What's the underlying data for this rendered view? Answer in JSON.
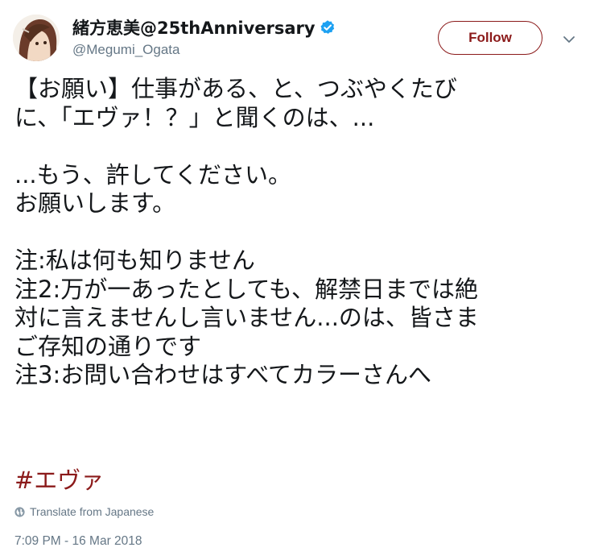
{
  "user": {
    "display_name": "緒方恵美@25thAnniversary",
    "handle": "@Megumi_Ogata",
    "verified": true,
    "avatar_icon": "avatar-icon"
  },
  "follow_button": {
    "label": "Follow"
  },
  "menu_icon": "chevron-down-icon",
  "tweet": {
    "lines": [
      "【お願い】仕事がある、と、つぶやくたび",
      "に、「エヴァ！？」と聞くのは、...",
      "",
      "...もう、許してください。",
      "お願いします。",
      "",
      "注:私は何も知りません",
      "注2:万が一あったとしても、解禁日までは絶",
      "対に言えませんし言いません...のは、皆さま",
      "ご存知の通りです",
      "注3:お問い合わせはすべてカラーさんへ"
    ],
    "hashtag": "#エヴァ"
  },
  "translate_label": "Translate from Japanese",
  "timestamp": "7:09 PM - 16 Mar 2018",
  "colors": {
    "accent": "#8b1a1a",
    "verified": "#1da1f2",
    "secondary_text": "#657786"
  }
}
